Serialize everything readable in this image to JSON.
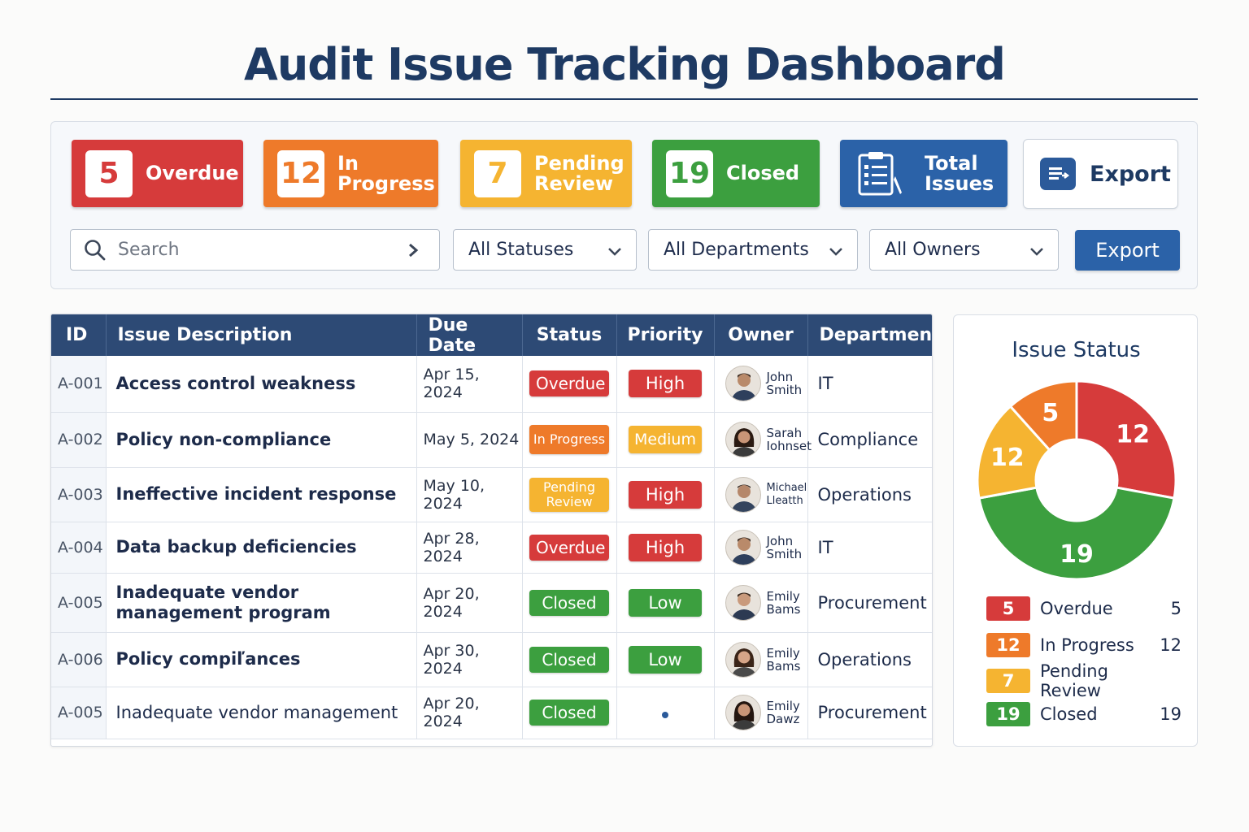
{
  "page": {
    "title": "Audit Issue Tracking Dashboard"
  },
  "summary": {
    "overdue": {
      "count": "5",
      "label": "Overdue",
      "color": "#d63b3b"
    },
    "in_progress": {
      "count": "12",
      "label": "In Progress",
      "color": "#ee7a2a"
    },
    "pending_review": {
      "count": "7",
      "label": "Pending Review",
      "color": "#f5b431"
    },
    "closed": {
      "count": "19",
      "label": "Closed",
      "color": "#3c9f3f"
    },
    "total": {
      "label": "Total Issues",
      "icon": "clipboard-checklist-icon",
      "color": "#2b62a8"
    },
    "export": {
      "label": "Export",
      "icon": "export-document-icon"
    }
  },
  "filters": {
    "search_placeholder": "Search",
    "status": "All Statuses",
    "department": "All Departments",
    "owner": "All Owners",
    "export_label": "Export"
  },
  "table": {
    "columns": [
      "ID",
      "Issue Description",
      "Due Date",
      "Status",
      "Priority",
      "Owner",
      "Department"
    ],
    "rows": [
      {
        "id": "A-001",
        "description": "Access control weakness",
        "due": "Apr 15, 2024",
        "status": "Overdue",
        "priority": "High",
        "owner_first": "John",
        "owner_last": "Smith",
        "department": "IT"
      },
      {
        "id": "A-002",
        "description": "Policy non-compliance",
        "due": "May 5, 2024",
        "status": "In Progress",
        "priority": "Medium",
        "owner_first": "Sarah",
        "owner_last": "Iohnset",
        "department": "Compliance"
      },
      {
        "id": "A-003",
        "description": "Ineffective incident response",
        "due": "May 10, 2024",
        "status": "Pending Review",
        "priority": "High",
        "owner_first": "Michael",
        "owner_last": "Lleatth",
        "department": "Operations"
      },
      {
        "id": "A-004",
        "description": "Data backup deficiencies",
        "due": "Apr 28, 2024",
        "status": "Overdue",
        "priority": "High",
        "owner_first": "John",
        "owner_last": "Smith",
        "department": "IT"
      },
      {
        "id": "A-005",
        "description": "Inadequate vendor management program",
        "due": "Apr 20, 2024",
        "status": "Closed",
        "priority": "Low",
        "owner_first": "Emily",
        "owner_last": "Bams",
        "department": "Procurement"
      },
      {
        "id": "A-006",
        "description": "Policy compiľances",
        "due": "Apr 30, 2024",
        "status": "Closed",
        "priority": "Low",
        "owner_first": "Emily",
        "owner_last": "Bams",
        "department": "Operations"
      },
      {
        "id": "A-005",
        "description": "Inadequate vendor management",
        "due": "Apr 20, 2024",
        "status": "Closed",
        "priority": "",
        "owner_first": "Emily",
        "owner_last": "Dawz",
        "department": "Procurement"
      }
    ]
  },
  "chart_data": {
    "type": "pie",
    "title": "Issue Status",
    "donut": true,
    "categories": [
      "Overdue",
      "In Progress",
      "Pending Review",
      "Closed"
    ],
    "values": [
      5,
      12,
      7,
      19
    ],
    "slice_labels": [
      "12",
      "19",
      "12",
      "5"
    ],
    "colors": [
      "#d63b3b",
      "#3c9f3f",
      "#f5b431",
      "#ee7a2a"
    ],
    "legend": [
      {
        "count": "5",
        "name": "Overdue",
        "value": "5",
        "color": "#d63b3b"
      },
      {
        "count": "12",
        "name": "In Progress",
        "value": "12",
        "color": "#ee7a2a"
      },
      {
        "count": "7",
        "name": "Pending Review",
        "value": "",
        "color": "#f5b431"
      },
      {
        "count": "19",
        "name": "Closed",
        "value": "19",
        "color": "#3c9f3f"
      }
    ]
  }
}
